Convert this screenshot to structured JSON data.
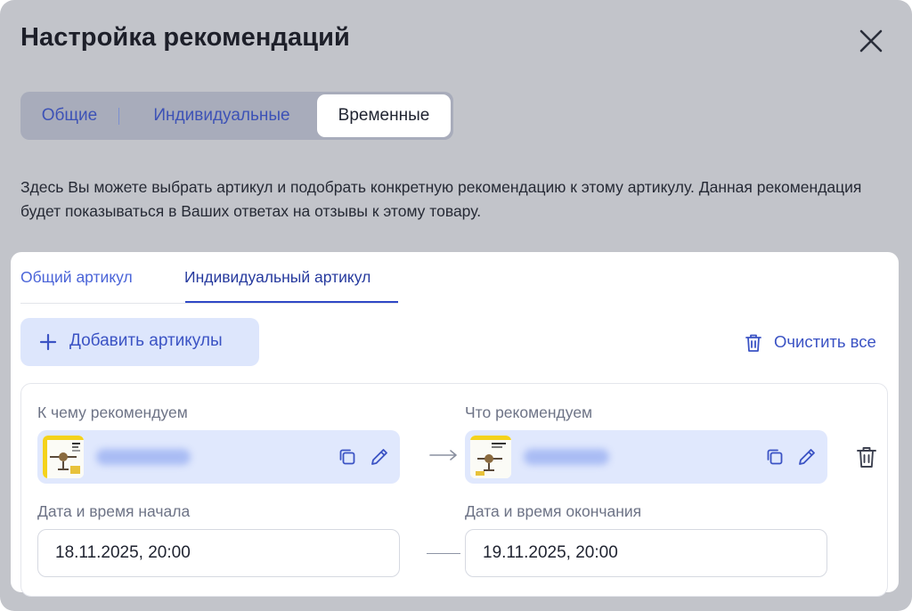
{
  "dialog": {
    "title": "Настройка рекомендаций"
  },
  "top_tabs": {
    "general": "Общие",
    "individual": "Индивидуальные",
    "temporary": "Временные",
    "active": "temporary"
  },
  "description": "Здесь Вы можете выбрать артикул и подобрать конкретную рекомендацию к этому артикулу. Данная рекомендация будет показываться в Ваших ответах на отзывы к этому товару.",
  "article_tabs": {
    "common": "Общий артикул",
    "individual": "Индивидуальный артикул",
    "active": "individual"
  },
  "toolbar": {
    "add_label": "Добавить артикулы",
    "clear_label": "Очистить все"
  },
  "rule": {
    "source_label": "К чему рекомендуем",
    "target_label": "Что рекомендуем",
    "start_label": "Дата и время начала",
    "end_label": "Дата и время окончания",
    "start_value": "18.11.2025, 20:00",
    "end_value": "19.11.2025, 20:00"
  },
  "colors": {
    "accent": "#3b53c4",
    "overlay": "#c2c4ca",
    "item_bg": "#e0e8fd"
  },
  "icons": [
    "close-icon",
    "plus-icon",
    "trash-icon",
    "copy-icon",
    "pencil-icon",
    "arrow-right-icon"
  ]
}
